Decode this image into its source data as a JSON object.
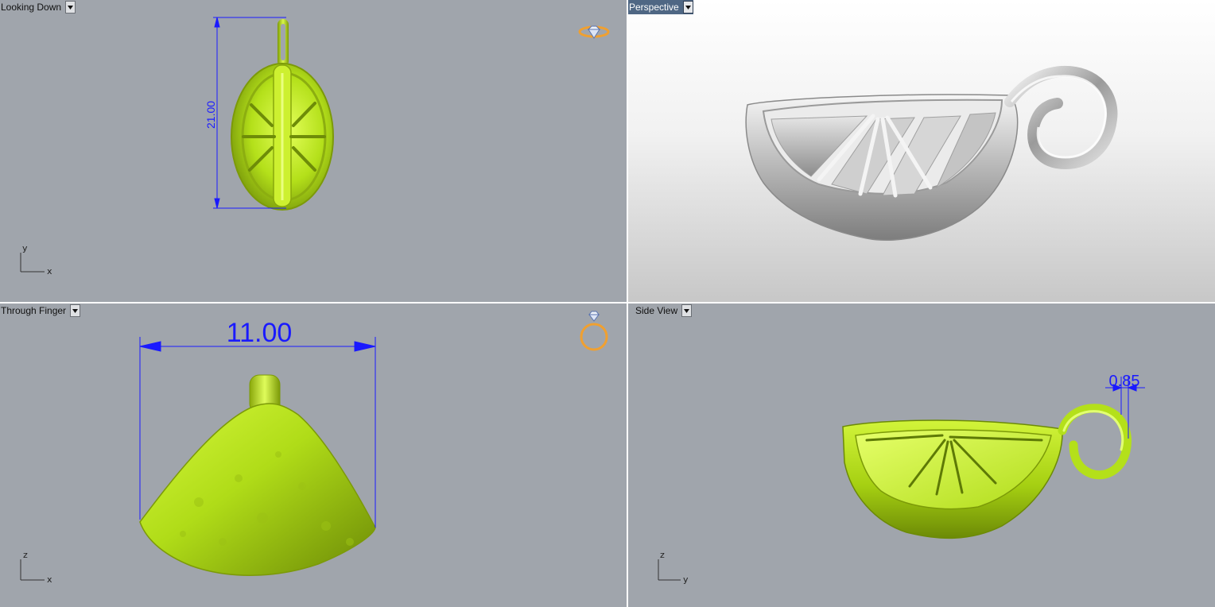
{
  "viewports": {
    "top": {
      "label": "Looking Down",
      "dimension": "21.00",
      "axes": {
        "vertical": "y",
        "horizontal": "x"
      }
    },
    "perspective": {
      "label": "Perspective"
    },
    "front": {
      "label": "Through Finger",
      "dimension": "11.00",
      "axes": {
        "vertical": "z",
        "horizontal": "x"
      }
    },
    "side": {
      "label": "Side View",
      "dimension": "0.85",
      "axes": {
        "vertical": "z",
        "horizontal": "y"
      }
    }
  },
  "colors": {
    "viewport_bg": "#a0a5ac",
    "model_green": "#b4e01a",
    "dimension_blue": "#1a1aff",
    "icon_orange": "#f0a030",
    "active_label": "#4f6784"
  },
  "icons": {
    "top": "gem-ring-top-icon",
    "front": "ring-front-icon",
    "dropdown": "triangle-down-icon"
  }
}
